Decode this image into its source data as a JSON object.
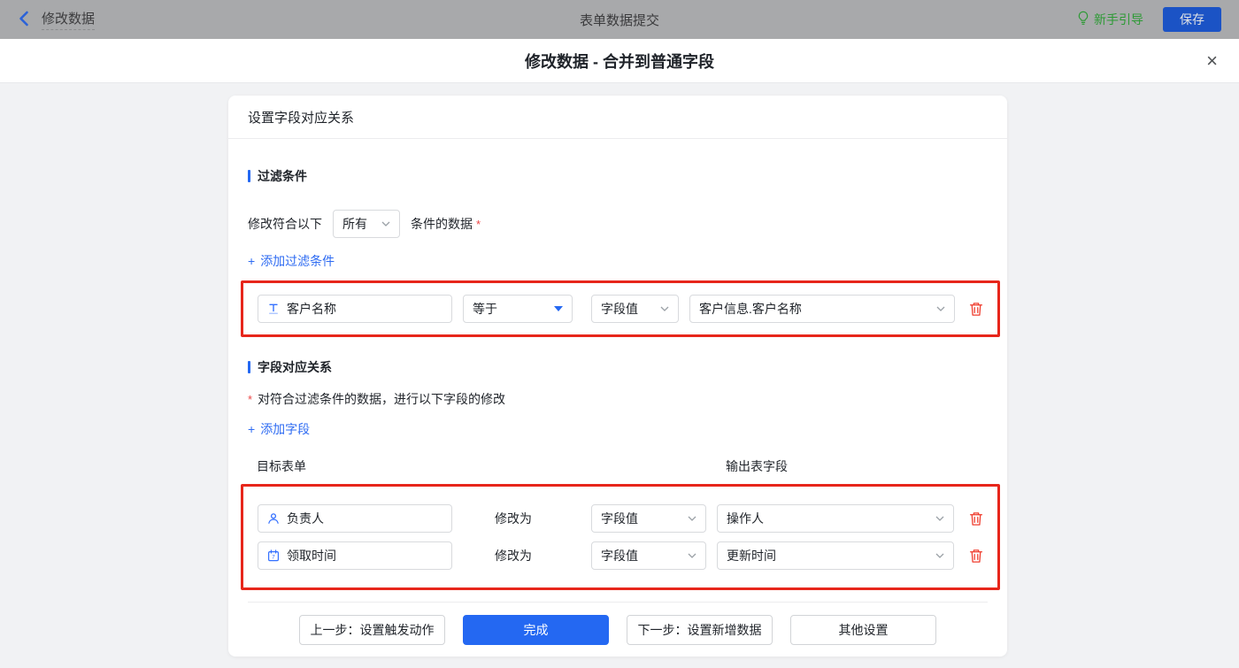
{
  "topbar": {
    "back_label": "修改数据",
    "center_title": "表单数据提交",
    "guide_label": "新手引导",
    "save_label": "保存"
  },
  "dialog": {
    "title": "修改数据 - 合并到普通字段",
    "close_icon": "×",
    "card_title": "设置字段对应关系"
  },
  "filter_section": {
    "title": "过滤条件",
    "match_prefix": "修改符合以下",
    "match_select_value": "所有",
    "match_suffix": "条件的数据",
    "required_mark": "*",
    "add_icon": "+",
    "add_label": "添加过滤条件",
    "row": {
      "field_icon": "text-field-icon",
      "field_value": "客户名称",
      "operator_value": "等于",
      "value_type_value": "字段值",
      "value_value": "客户信息.客户名称"
    }
  },
  "mapping_section": {
    "title": "字段对应关系",
    "required_mark": "*",
    "description": "对符合过滤条件的数据，进行以下字段的修改",
    "add_icon": "+",
    "add_label": "添加字段",
    "col_left": "目标表单",
    "col_right": "输出表字段",
    "modify_label": "修改为",
    "rows": [
      {
        "field_icon": "user-icon",
        "field_value": "负责人",
        "value_type_value": "字段值",
        "value_value": "操作人"
      },
      {
        "field_icon": "calendar-icon",
        "field_value": "领取时间",
        "value_type_value": "字段值",
        "value_value": "更新时间"
      }
    ]
  },
  "footer": {
    "prev_label": "上一步：设置触发动作",
    "done_label": "完成",
    "next_label": "下一步：设置新增数据",
    "other_label": "其他设置"
  },
  "colors": {
    "accent_blue": "#2468f2",
    "highlight_red": "#e7261b",
    "guide_green": "#2d9a35",
    "danger_icon_red": "#ef3c2d",
    "topbar_dimmed_gray": "#a8a9ab"
  }
}
